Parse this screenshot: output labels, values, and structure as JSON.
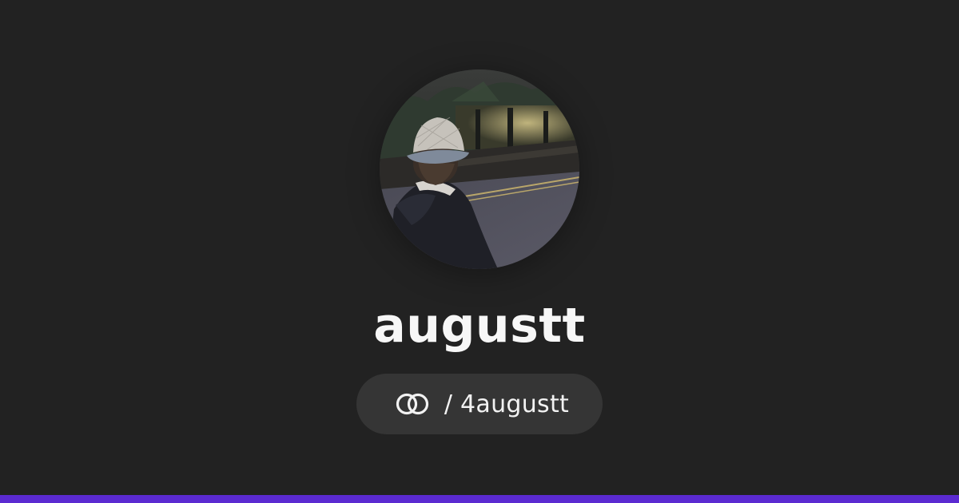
{
  "profile": {
    "display_name": "augustt",
    "handle_separator": "/",
    "handle": "4augustt",
    "avatar_icon": "profile-photo-person-in-bucket-hat-at-night",
    "logo_icon": "interlocked-rings-icon"
  },
  "colors": {
    "background": "#222222",
    "pill_background": "#353535",
    "text": "#f7f7f7",
    "accent_bar": "#5b2ad1"
  }
}
